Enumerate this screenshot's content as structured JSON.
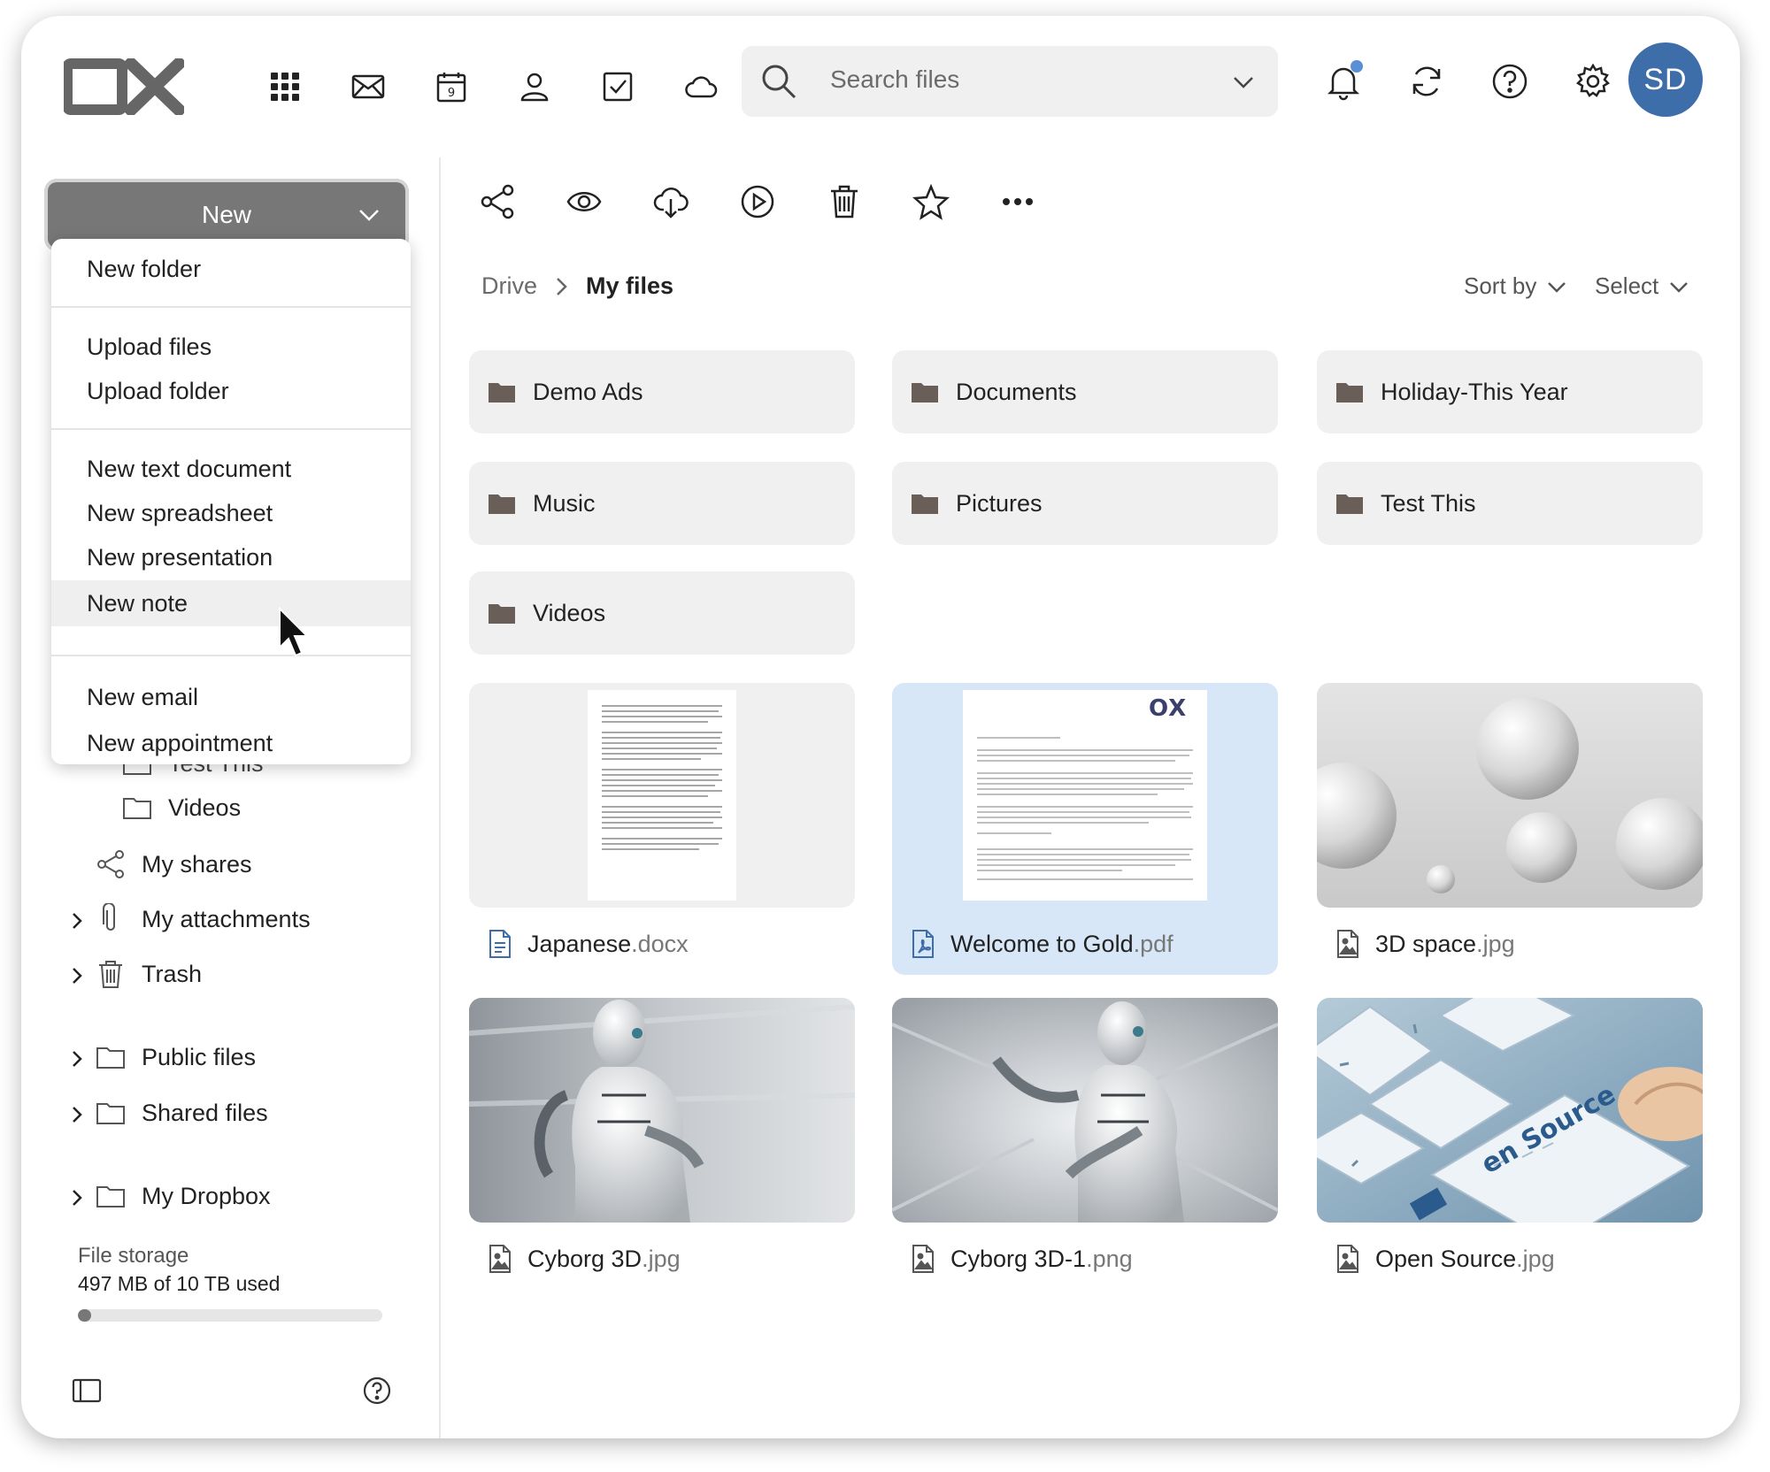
{
  "header": {
    "search_placeholder": "Search files",
    "avatar_initials": "SD",
    "accent": "#3e6ea9"
  },
  "sidebar": {
    "new_button": "New",
    "tree": {
      "partial_item": "Test This",
      "videos": "Videos",
      "my_shares": "My shares",
      "my_attachments": "My attachments",
      "trash": "Trash",
      "public_files": "Public files",
      "shared_files": "Shared files",
      "my_dropbox": "My Dropbox"
    },
    "storage": {
      "title": "File storage",
      "used": "497 MB of 10 TB used",
      "fraction_used": 0.045
    }
  },
  "menu": {
    "items": [
      "New folder",
      "Upload files",
      "Upload folder",
      "New text document",
      "New spreadsheet",
      "New presentation",
      "New note",
      "New email",
      "New appointment"
    ],
    "hovered": "New note"
  },
  "content": {
    "breadcrumb": {
      "root": "Drive",
      "current": "My files"
    },
    "sort_label": "Sort by",
    "select_label": "Select",
    "folders": [
      "Demo Ads",
      "Documents",
      "Holiday-This Year",
      "Music",
      "Pictures",
      "Test This",
      "Videos"
    ],
    "files": [
      {
        "base": "Japanese",
        "ext": ".docx",
        "icon": "document-icon"
      },
      {
        "base": "Welcome to Gold",
        "ext": ".pdf",
        "icon": "pdf-icon",
        "selected": true
      },
      {
        "base": "3D space",
        "ext": ".jpg",
        "icon": "image-file-icon"
      },
      {
        "base": "Cyborg 3D",
        "ext": ".jpg",
        "icon": "image-file-icon"
      },
      {
        "base": "Cyborg 3D-1",
        "ext": ".png",
        "icon": "image-file-icon"
      },
      {
        "base": "Open Source",
        "ext": ".jpg",
        "icon": "image-file-icon"
      }
    ],
    "thumb_texts": {
      "pdf_brand": "OX",
      "keyboard_text": "en Source"
    }
  }
}
